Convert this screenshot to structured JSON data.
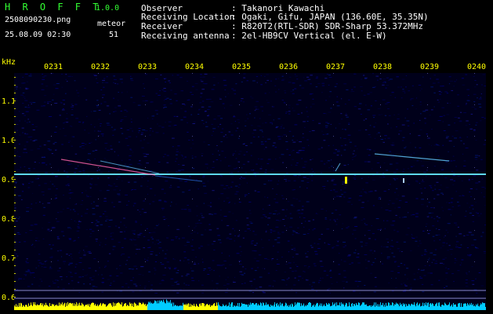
{
  "header": {
    "app_title": "H R O F F T",
    "version": "1.0.0",
    "filename": "2508090230.png",
    "mode": "meteor",
    "datetime": "25.08.09 02:30",
    "count": "51",
    "info_labels": [
      "Observer",
      "Receiving Location",
      "Receiver",
      "Receiving antenna"
    ],
    "info_values": [
      ": Takanori Kawachi",
      ": Ogaki, Gifu, JAPAN (136.60E, 35.35N)",
      ": R820T2(RTL-SDR) SDR-Sharp 53.372MHz",
      ": 2el-HB9CV Vertical (el. E-W)"
    ]
  },
  "axis": {
    "unit": "kHz",
    "time_labels": [
      "0231",
      "0232",
      "0233",
      "0234",
      "0235",
      "0236",
      "0237",
      "0238",
      "0239",
      "0240"
    ],
    "freq_labels": [
      "1.1",
      "1.0",
      "0.9",
      "0.8",
      "0.7",
      "0.6"
    ],
    "freq_range": [
      0.58,
      1.17
    ]
  },
  "colors": {
    "title_green": "#33ff33",
    "axis_yellow": "#ffff00",
    "carrier": "#44ccff",
    "meteor": "#ff66aa",
    "noise_dark": "#000022",
    "level_yellow": "#ffff00",
    "level_cyan": "#00ccff"
  }
}
